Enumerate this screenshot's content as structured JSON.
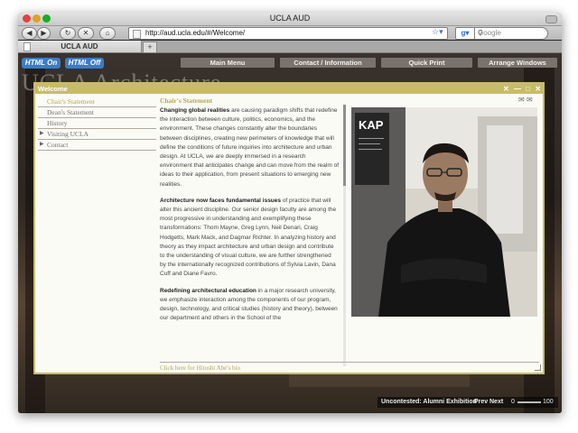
{
  "browser": {
    "title": "UCLA AUD",
    "url": "http://aud.ucla.edu/#/Welcome/",
    "search_placeholder": "Google",
    "tab_label": "UCLA AUD",
    "new_tab_symbol": "+"
  },
  "site": {
    "html_on": "HTML On",
    "html_off": "HTML Off",
    "menu": [
      "Main Menu",
      "Contact / Information",
      "Quick Print",
      "Arrange Windows"
    ],
    "background_text": "UCLA Architecture"
  },
  "panel": {
    "title": "Welcome",
    "controls": [
      "✕",
      "—",
      "□",
      "✕"
    ],
    "nav": [
      {
        "label": "Chair's Statement",
        "active": true,
        "expandable": false
      },
      {
        "label": "Dean's Statement",
        "active": false,
        "expandable": false
      },
      {
        "label": "History",
        "active": false,
        "expandable": false
      },
      {
        "label": "Visiting UCLA",
        "active": false,
        "expandable": true
      },
      {
        "label": "Contact",
        "active": false,
        "expandable": true
      }
    ],
    "content_title": "Chair's Statement",
    "paragraphs": [
      {
        "bold": "Changing global realities",
        "text": " are causing paradigm shifts that redefine the interaction between culture, politics, economics, and the environment. These changes constantly alter the boundaries between disciplines, creating new perimeters of knowledge that will define the conditions of future inquiries into architecture and urban design. At UCLA, we are deeply immersed in a research environment that anticipates change and can move from the realm of ideas to their application, from present situations to emerging new realities."
      },
      {
        "bold": "Architecture now faces fundamental issues",
        "text": " of practice that will alter this ancient discipline. Our senior design faculty are among the most progressive in understanding and exemplifying these transformations: Thom Mayne, Greg Lynn, Neil Denari, Craig Hodgetts, Mark Mack, and Dagmar Richter. In analyzing history and theory as they impact architecture and urban design and contribute to the understanding of visual culture, we are further strengthened by the internationally recognized contributions of Sylvia Lavin, Dana Cuff and Diane Favro."
      },
      {
        "bold": "Redefining architectural education",
        "text": " in a major research university, we emphasize interaction among the components of our program, design, technology, and critical studies (history and theory), between our department and others in the School of the"
      }
    ],
    "footer_link": "Click here for Hitoshi Abe's bio",
    "photo_sign": "KAP"
  },
  "bottom": {
    "exhibition": "Uncontested: Alumni Exhibition",
    "prev": "Prev",
    "next": "Next",
    "zoom_min": "0",
    "zoom_max": "100"
  },
  "colors": {
    "accent": "#c8bc6a",
    "nav_active": "#b5a64a",
    "pill_blue": "#3a7dc8"
  }
}
